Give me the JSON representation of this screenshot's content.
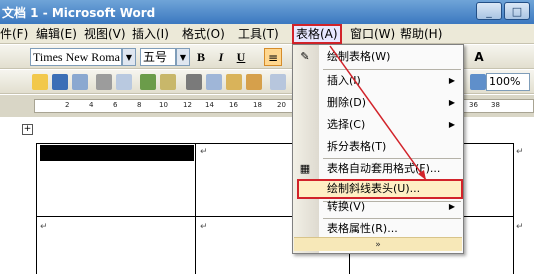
{
  "window": {
    "title": "文档 1 - Microsoft Word",
    "minimize": "_",
    "restore": "□"
  },
  "menubar": [
    {
      "label": "文件(F)"
    },
    {
      "label": "编辑(E)"
    },
    {
      "label": "视图(V)"
    },
    {
      "label": "插入(I)"
    },
    {
      "label": "格式(O)"
    },
    {
      "label": "工具(T)"
    },
    {
      "label": "表格(A)"
    },
    {
      "label": "窗口(W)"
    },
    {
      "label": "帮助(H)"
    }
  ],
  "formatting": {
    "font": "Times New Roma",
    "size": "五号",
    "bold": "B",
    "italic": "I",
    "underline": "U",
    "right_glyphs": "A A"
  },
  "standard": {
    "zoom": "100%"
  },
  "ruler": {
    "ticks": [
      "2",
      "4",
      "6",
      "8",
      "10",
      "12",
      "14",
      "16",
      "18",
      "20",
      "36",
      "38"
    ]
  },
  "table_menu": {
    "items": [
      {
        "label": "绘制表格(W)"
      },
      {
        "label": "插入(I)"
      },
      {
        "label": "删除(D)"
      },
      {
        "label": "选择(C)"
      },
      {
        "label": "拆分表格(T)"
      },
      {
        "label": "表格自动套用格式(F)..."
      },
      {
        "label": "绘制斜线表头(U)..."
      },
      {
        "label": "转换(V)"
      },
      {
        "label": "表格属性(R)..."
      }
    ],
    "expand": "»"
  },
  "icons": {
    "draw_table": "pencil-icon",
    "autoformat": "autoformat-icon",
    "submenu": "triangle-right-icon"
  },
  "colors": {
    "highlight_border": "#d2232a",
    "arrow": "#d2232a",
    "titlebar": "#3b78c0"
  }
}
